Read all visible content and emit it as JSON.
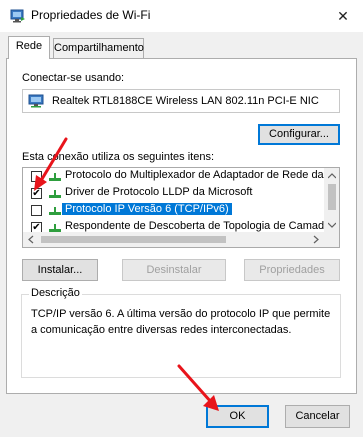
{
  "window": {
    "title": "Propriedades de Wi-Fi",
    "close_glyph": "✕"
  },
  "tabs": [
    {
      "label": "Rede",
      "active": true
    },
    {
      "label": "Compartilhamento",
      "active": false
    }
  ],
  "connect_using": {
    "label": "Conectar-se usando:",
    "adapter": "Realtek RTL8188CE Wireless LAN 802.11n PCI-E NIC",
    "configure_button": "Configurar..."
  },
  "items_section": {
    "label": "Esta conexão utiliza os seguintes itens:",
    "items": [
      {
        "label": "Protocolo do Multiplexador de Adaptador de Rede da M",
        "checked": false,
        "selected": false
      },
      {
        "label": "Driver de Protocolo LLDP da Microsoft",
        "checked": true,
        "selected": false
      },
      {
        "label": "Protocolo IP Versão 6 (TCP/IPv6)",
        "checked": false,
        "selected": true
      },
      {
        "label": "Respondente de Descoberta de Topologia de Camada",
        "checked": true,
        "selected": false
      }
    ]
  },
  "action_buttons": {
    "install": "Instalar...",
    "uninstall": "Desinstalar",
    "properties": "Propriedades"
  },
  "description": {
    "legend": "Descrição",
    "text": "TCP/IP versão 6. A última versão do protocolo IP que permite a comunicação entre diversas redes interconectadas."
  },
  "dialog_buttons": {
    "ok": "OK",
    "cancel": "Cancelar"
  },
  "colors": {
    "selection": "#0078d7",
    "annotation_arrow": "#e8141b",
    "network_icon_green": "#2e9e3e"
  },
  "icons": {
    "title": "wifi-network-icon",
    "adapter": "network-adapter-icon",
    "protocol": "network-protocol-icon"
  }
}
